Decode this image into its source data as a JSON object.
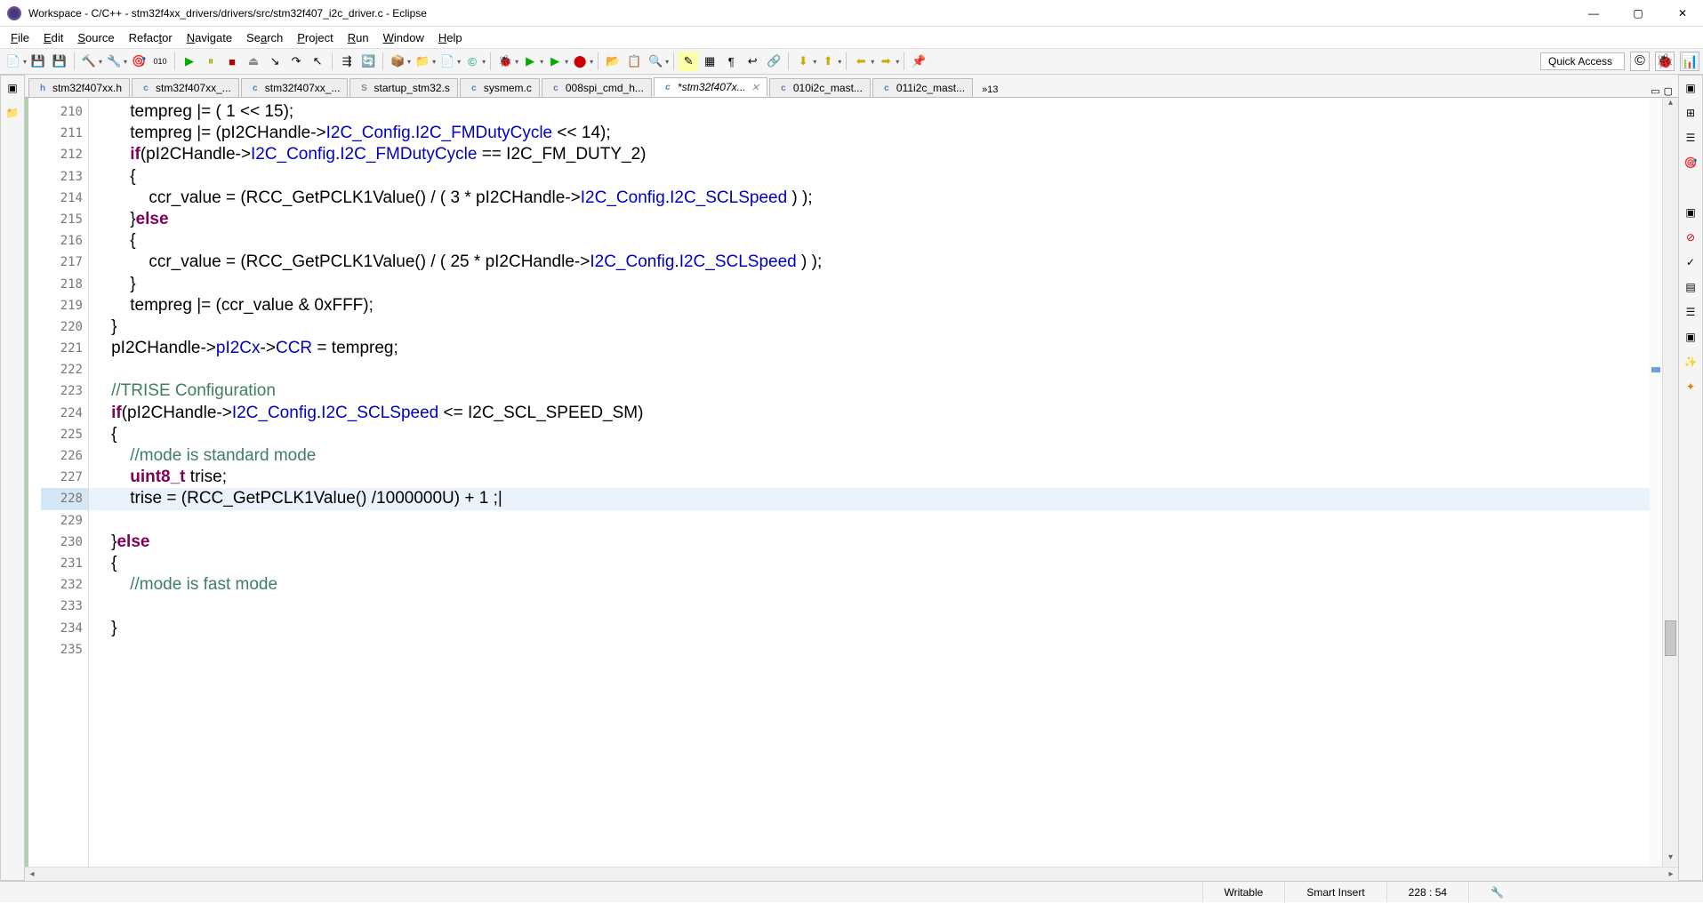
{
  "window": {
    "title": "Workspace - C/C++ - stm32f4xx_drivers/drivers/src/stm32f407_i2c_driver.c - Eclipse"
  },
  "menubar": {
    "items": [
      "File",
      "Edit",
      "Source",
      "Refactor",
      "Navigate",
      "Search",
      "Project",
      "Run",
      "Window",
      "Help"
    ]
  },
  "toolbar": {
    "quick_access": "Quick Access"
  },
  "tabs": {
    "items": [
      {
        "icon": "h",
        "label": "stm32f407xx.h"
      },
      {
        "icon": "c",
        "label": "stm32f407xx_..."
      },
      {
        "icon": "c",
        "label": "stm32f407xx_..."
      },
      {
        "icon": "s",
        "label": "startup_stm32.s"
      },
      {
        "icon": "c",
        "label": "sysmem.c"
      },
      {
        "icon": "c",
        "label": "008spi_cmd_h..."
      },
      {
        "icon": "c",
        "label": "*stm32f407x...",
        "active": true
      },
      {
        "icon": "c",
        "label": "010i2c_mast..."
      },
      {
        "icon": "c",
        "label": "011i2c_mast..."
      }
    ],
    "overflow": "»13"
  },
  "code": {
    "lines": [
      {
        "n": 210,
        "html": "        tempreg |= ( 1 << 15);"
      },
      {
        "n": 211,
        "html": "        tempreg |= (pI2CHandle-><span class='mem'>I2C_Config</span>.<span class='mem'>I2C_FMDutyCycle</span> << 14);"
      },
      {
        "n": 212,
        "html": "        <span class='kw'>if</span>(pI2CHandle-><span class='mem'>I2C_Config</span>.<span class='mem'>I2C_FMDutyCycle</span> == I2C_FM_DUTY_2)"
      },
      {
        "n": 213,
        "html": "        {"
      },
      {
        "n": 214,
        "html": "            ccr_value = (RCC_GetPCLK1Value() / ( 3 * pI2CHandle-><span class='mem'>I2C_Config</span>.<span class='mem'>I2C_SCLSpeed</span> ) );"
      },
      {
        "n": 215,
        "html": "        }<span class='kw'>else</span>"
      },
      {
        "n": 216,
        "html": "        {"
      },
      {
        "n": 217,
        "html": "            ccr_value = (RCC_GetPCLK1Value() / ( 25 * pI2CHandle-><span class='mem'>I2C_Config</span>.<span class='mem'>I2C_SCLSpeed</span> ) );"
      },
      {
        "n": 218,
        "html": "        }"
      },
      {
        "n": 219,
        "html": "        tempreg |= (ccr_value & 0xFFF);"
      },
      {
        "n": 220,
        "html": "    }"
      },
      {
        "n": 221,
        "html": "    pI2CHandle-><span class='mem'>pI2Cx</span>-><span class='mem'>CCR</span> = tempreg;"
      },
      {
        "n": 222,
        "html": ""
      },
      {
        "n": 223,
        "html": "    <span class='cmt'>//TRISE Configuration</span>"
      },
      {
        "n": 224,
        "html": "    <span class='kw'>if</span>(pI2CHandle-><span class='mem'>I2C_Config</span>.<span class='mem'>I2C_SCLSpeed</span> <= I2C_SCL_SPEED_SM)"
      },
      {
        "n": 225,
        "html": "    {"
      },
      {
        "n": 226,
        "html": "        <span class='cmt'>//mode is standard mode</span>"
      },
      {
        "n": 227,
        "html": "        <span class='typ'>uint8_t</span> trise;"
      },
      {
        "n": 228,
        "html": "        trise = (RCC_GetPCLK1Value() /1000000U) + 1 ;|",
        "current": true
      },
      {
        "n": 229,
        "html": ""
      },
      {
        "n": 230,
        "html": "    }<span class='kw'>else</span>"
      },
      {
        "n": 231,
        "html": "    {"
      },
      {
        "n": 232,
        "html": "        <span class='cmt'>//mode is fast mode</span>"
      },
      {
        "n": 233,
        "html": ""
      },
      {
        "n": 234,
        "html": "    }"
      },
      {
        "n": 235,
        "html": ""
      }
    ]
  },
  "statusbar": {
    "writable": "Writable",
    "insert": "Smart Insert",
    "position": "228 : 54"
  }
}
